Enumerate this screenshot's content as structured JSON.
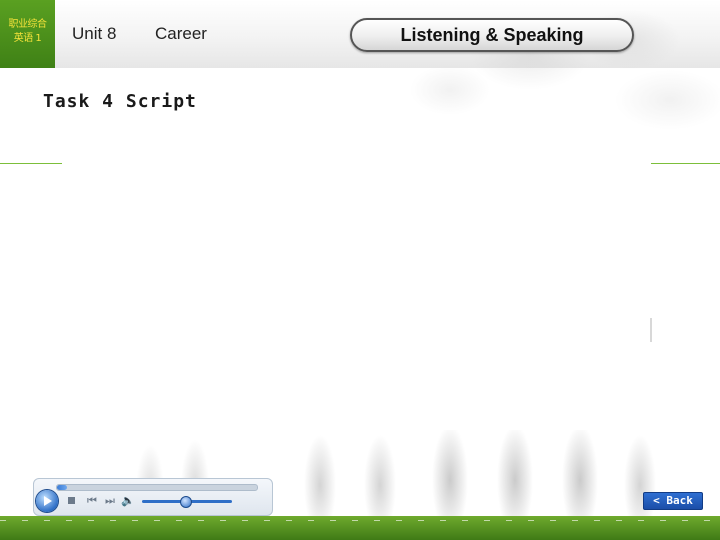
{
  "header": {
    "logo_line1": "职业综合",
    "logo_line2": "英语 1",
    "unit": "Unit 8",
    "topic": "Career",
    "section": "Listening & Speaking"
  },
  "content": {
    "title": "Task 4 Script"
  },
  "player": {
    "play_icon": "play-icon",
    "stop_icon": "stop-icon",
    "prev_icon": "previous-icon",
    "next_icon": "next-icon",
    "volume_icon": "volume-icon",
    "seek_progress_fraction": 0.05
  },
  "nav": {
    "back_label": "< Back"
  },
  "colors": {
    "brand_green": "#4a8f1c",
    "logo_text": "#f5e23a",
    "back_button": "#2f6fd2"
  }
}
